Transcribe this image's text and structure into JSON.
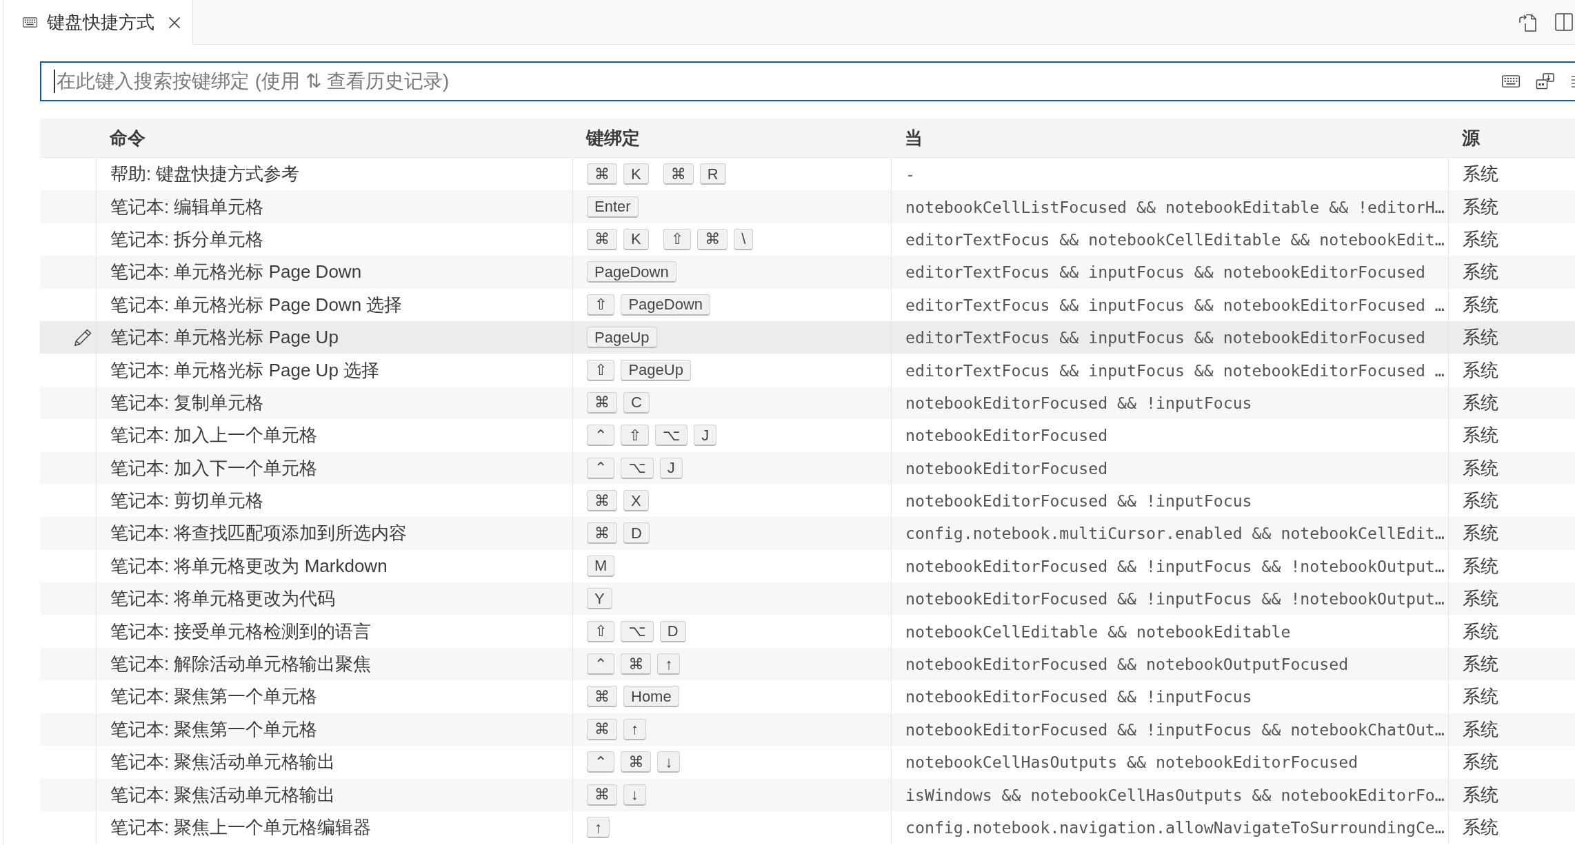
{
  "tab": {
    "title": "键盘快捷方式"
  },
  "search": {
    "placeholder": "在此键入搜索按键绑定 (使用 ⇅ 查看历史记录)"
  },
  "table": {
    "columns": [
      "命令",
      "键绑定",
      "当",
      "源"
    ],
    "rows": [
      {
        "command": "帮助: 键盘快捷方式参考",
        "keybinding": [
          [
            "⌘",
            "K"
          ],
          [
            "⌘",
            "R"
          ]
        ],
        "when": "-",
        "source": "系统",
        "selected": false
      },
      {
        "command": "笔记本: 编辑单元格",
        "keybinding": [
          [
            "Enter"
          ]
        ],
        "when": "notebookCellListFocused && notebookEditable && !editorH…",
        "source": "系统",
        "selected": false
      },
      {
        "command": "笔记本: 拆分单元格",
        "keybinding": [
          [
            "⌘",
            "K"
          ],
          [
            "⇧",
            "⌘",
            "\\"
          ]
        ],
        "when": "editorTextFocus && notebookCellEditable && notebookEdit…",
        "source": "系统",
        "selected": false
      },
      {
        "command": "笔记本: 单元格光标 Page Down",
        "keybinding": [
          [
            "PageDown"
          ]
        ],
        "when": "editorTextFocus && inputFocus && notebookEditorFocused",
        "source": "系统",
        "selected": false
      },
      {
        "command": "笔记本: 单元格光标 Page Down 选择",
        "keybinding": [
          [
            "⇧",
            "PageDown"
          ]
        ],
        "when": "editorTextFocus && inputFocus && notebookEditorFocused …",
        "source": "系统",
        "selected": false
      },
      {
        "command": "笔记本: 单元格光标 Page Up",
        "keybinding": [
          [
            "PageUp"
          ]
        ],
        "when": "editorTextFocus && inputFocus && notebookEditorFocused",
        "source": "系统",
        "selected": true
      },
      {
        "command": "笔记本: 单元格光标 Page Up 选择",
        "keybinding": [
          [
            "⇧",
            "PageUp"
          ]
        ],
        "when": "editorTextFocus && inputFocus && notebookEditorFocused …",
        "source": "系统",
        "selected": false
      },
      {
        "command": "笔记本: 复制单元格",
        "keybinding": [
          [
            "⌘",
            "C"
          ]
        ],
        "when": "notebookEditorFocused && !inputFocus",
        "source": "系统",
        "selected": false
      },
      {
        "command": "笔记本: 加入上一个单元格",
        "keybinding": [
          [
            "⌃",
            "⇧",
            "⌥",
            "J"
          ]
        ],
        "when": "notebookEditorFocused",
        "source": "系统",
        "selected": false
      },
      {
        "command": "笔记本: 加入下一个单元格",
        "keybinding": [
          [
            "⌃",
            "⌥",
            "J"
          ]
        ],
        "when": "notebookEditorFocused",
        "source": "系统",
        "selected": false
      },
      {
        "command": "笔记本: 剪切单元格",
        "keybinding": [
          [
            "⌘",
            "X"
          ]
        ],
        "when": "notebookEditorFocused && !inputFocus",
        "source": "系统",
        "selected": false
      },
      {
        "command": "笔记本: 将查找匹配项添加到所选内容",
        "keybinding": [
          [
            "⌘",
            "D"
          ]
        ],
        "when": "config.notebook.multiCursor.enabled && notebookCellEdit…",
        "source": "系统",
        "selected": false
      },
      {
        "command": "笔记本: 将单元格更改为 Markdown",
        "keybinding": [
          [
            "M"
          ]
        ],
        "when": "notebookEditorFocused && !inputFocus && !notebookOutput…",
        "source": "系统",
        "selected": false
      },
      {
        "command": "笔记本: 将单元格更改为代码",
        "keybinding": [
          [
            "Y"
          ]
        ],
        "when": "notebookEditorFocused && !inputFocus && !notebookOutput…",
        "source": "系统",
        "selected": false
      },
      {
        "command": "笔记本: 接受单元格检测到的语言",
        "keybinding": [
          [
            "⇧",
            "⌥",
            "D"
          ]
        ],
        "when": "notebookCellEditable && notebookEditable",
        "source": "系统",
        "selected": false
      },
      {
        "command": "笔记本: 解除活动单元格输出聚焦",
        "keybinding": [
          [
            "⌃",
            "⌘",
            "↑"
          ]
        ],
        "when": "notebookEditorFocused && notebookOutputFocused",
        "source": "系统",
        "selected": false
      },
      {
        "command": "笔记本: 聚焦第一个单元格",
        "keybinding": [
          [
            "⌘",
            "Home"
          ]
        ],
        "when": "notebookEditorFocused && !inputFocus",
        "source": "系统",
        "selected": false
      },
      {
        "command": "笔记本: 聚焦第一个单元格",
        "keybinding": [
          [
            "⌘",
            "↑"
          ]
        ],
        "when": "notebookEditorFocused && !inputFocus && notebookChatOut…",
        "source": "系统",
        "selected": false
      },
      {
        "command": "笔记本: 聚焦活动单元格输出",
        "keybinding": [
          [
            "⌃",
            "⌘",
            "↓"
          ]
        ],
        "when": "notebookCellHasOutputs && notebookEditorFocused",
        "source": "系统",
        "selected": false
      },
      {
        "command": "笔记本: 聚焦活动单元格输出",
        "keybinding": [
          [
            "⌘",
            "↓"
          ]
        ],
        "when": "isWindows && notebookCellHasOutputs && notebookEditorFo…",
        "source": "系统",
        "selected": false
      },
      {
        "command": "笔记本: 聚焦上一个单元格编辑器",
        "keybinding": [
          [
            "↑"
          ]
        ],
        "when": "config.notebook.navigation.allowNavigateToSurroundingCe…",
        "source": "系统",
        "selected": false
      }
    ]
  }
}
